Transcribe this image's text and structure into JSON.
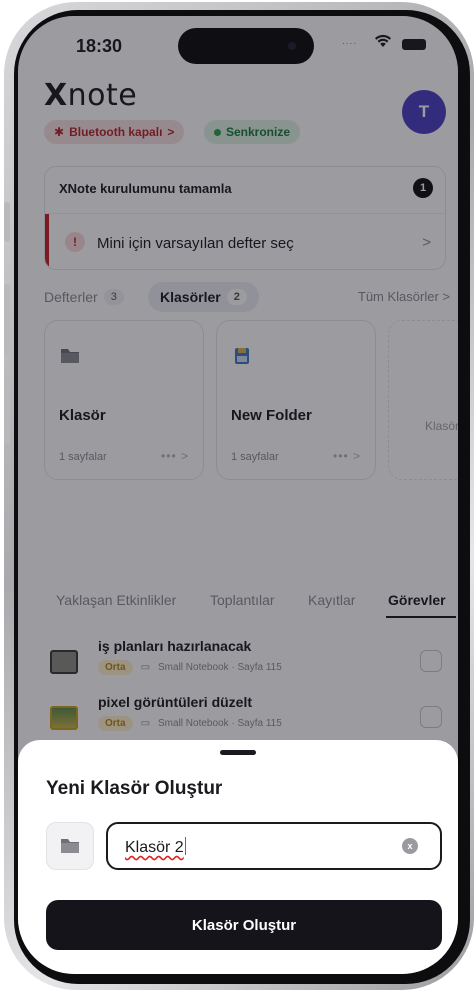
{
  "status_bar": {
    "time": "18:30",
    "signal": "....",
    "wifi_icon": "wifi-icon",
    "battery_icon": "battery-icon"
  },
  "header": {
    "app_name": "note",
    "logo_mark": "X",
    "avatar_initial": "T",
    "avatar_color": "#4a3fc2",
    "bluetooth_chip": "Bluetooth kapalı",
    "bluetooth_chev": ">",
    "sync_chip": "Senkronize"
  },
  "setup_card": {
    "title": "XNote kurulumunu tamamla",
    "count": "1",
    "row_label": "Mini için varsayılan defter seç",
    "row_icon": "alert-icon",
    "row_chev": ">"
  },
  "tabs": {
    "notebooks_label": "Defterler",
    "notebooks_count": "3",
    "folders_label": "Klasörler",
    "folders_count": "2",
    "all_folders_link": "Tüm Klasörler >"
  },
  "folders": [
    {
      "name": "Klasör",
      "meta": "1 sayfalar",
      "actions": "••• >",
      "icon": "folder-icon"
    },
    {
      "name": "New Folder",
      "meta": "1 sayfalar",
      "actions": "••• >",
      "icon": "folder-blue-icon"
    }
  ],
  "ghost_folder_label": "Klasör",
  "lower_tabs": [
    {
      "label": "Yaklaşan Etkinlikler",
      "active": false
    },
    {
      "label": "Toplantılar",
      "active": false
    },
    {
      "label": "Kayıtlar",
      "active": false
    },
    {
      "label": "Görevler",
      "active": true
    }
  ],
  "tasks": [
    {
      "title": "iş planları hazırlanacak",
      "priority": "Orta",
      "source": "Small Notebook · Sayfa 115"
    },
    {
      "title": "pixel görüntüleri düzelt",
      "priority": "Orta",
      "source": "Small Notebook · Sayfa 115"
    }
  ],
  "sheet": {
    "title": "Yeni Klasör Oluştur",
    "input_value": "Klasör 2",
    "clear_icon": "x",
    "create_button": "Klasör Oluştur"
  }
}
